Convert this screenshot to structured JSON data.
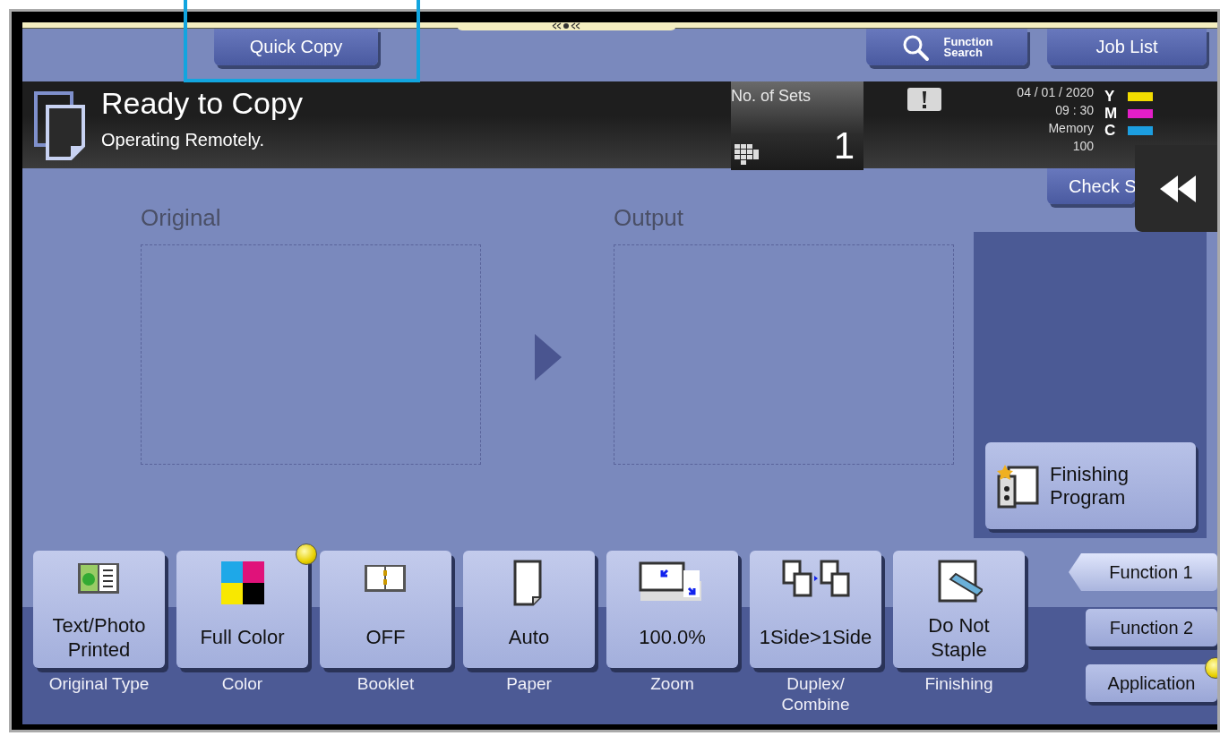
{
  "top_buttons": [
    {
      "label": "Quick Copy",
      "kind": "plain"
    },
    {
      "label": "Function\nSearch",
      "kind": "search"
    },
    {
      "label": "Job List",
      "kind": "plain"
    }
  ],
  "status": {
    "title": "Ready to Copy",
    "message": "Operating Remotely.",
    "sets_label": "No. of Sets",
    "sets_value": "1",
    "date": "04 / 01 / 2020",
    "time": "09 : 30",
    "memory_label": "Memory",
    "memory_value": "100"
  },
  "toner": [
    {
      "letter": "Y",
      "color": "#f2dc00"
    },
    {
      "letter": "M",
      "color": "#e41ec8"
    },
    {
      "letter": "C",
      "color": "#1c9ee0"
    }
  ],
  "check_button": "Check S",
  "panels": [
    {
      "label": "Original"
    },
    {
      "label": "Output"
    }
  ],
  "finishing_program": "Finishing\nProgram",
  "functions": [
    {
      "value": "Text/Photo\nPrinted",
      "caption": "Original Type",
      "kind": "original_type",
      "badge": false
    },
    {
      "value": "Full Color",
      "caption": "Color",
      "kind": "color",
      "badge": true
    },
    {
      "value": "OFF",
      "caption": "Booklet",
      "kind": "booklet",
      "badge": false
    },
    {
      "value": "Auto",
      "caption": "Paper",
      "kind": "paper",
      "badge": false
    },
    {
      "value": "100.0%",
      "caption": "Zoom",
      "kind": "zoom",
      "badge": false
    },
    {
      "value": "1Side>1Side",
      "caption": "Duplex/\nCombine",
      "kind": "duplex",
      "badge": false
    },
    {
      "value": "Do Not\nStaple",
      "caption": "Finishing",
      "kind": "finishing",
      "badge": false
    }
  ],
  "side_tabs": [
    {
      "label": "Function 1",
      "selected": true,
      "badge": false
    },
    {
      "label": "Function 2",
      "selected": false,
      "badge": false
    },
    {
      "label": "Application",
      "selected": false,
      "badge": true
    }
  ]
}
